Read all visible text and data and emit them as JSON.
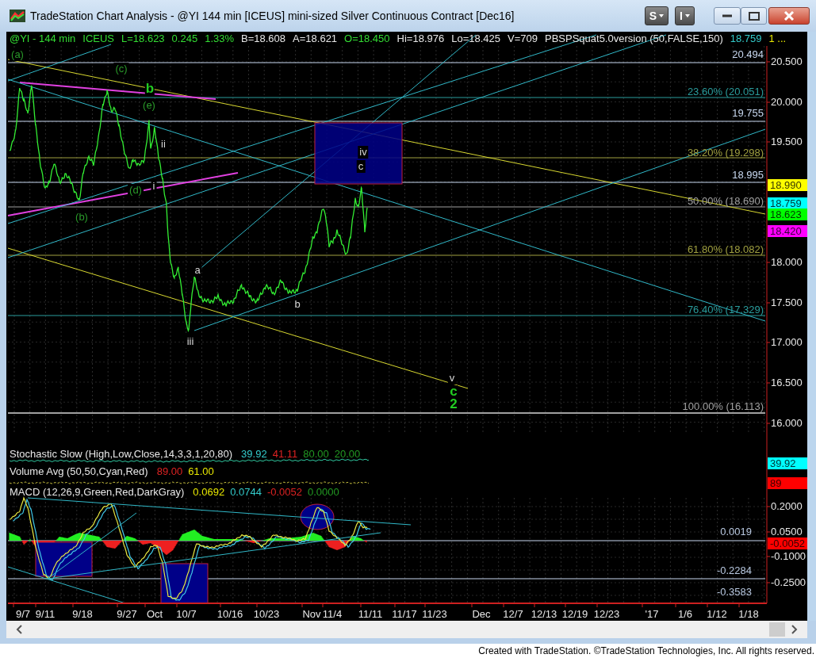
{
  "window": {
    "title": "TradeStation Chart Analysis - @YI 144 min [ICEUS] mini-sized Silver Continuous Contract [Dec16]"
  },
  "toolbar_buttons": [
    {
      "label": "S"
    },
    {
      "label": "I"
    }
  ],
  "symbol_header": [
    {
      "text": "@YI - 144 min",
      "color": "#33dd33"
    },
    {
      "text": "ICEUS",
      "color": "#33dd33"
    },
    {
      "text": "L=18.623",
      "color": "#33dd33"
    },
    {
      "text": "0.245",
      "color": "#33dd33"
    },
    {
      "text": "1.33%",
      "color": "#33dd33"
    },
    {
      "text": "B=18.608",
      "color": "#e8e8e8"
    },
    {
      "text": "A=18.621",
      "color": "#e8e8e8"
    },
    {
      "text": "O=18.450",
      "color": "#33dd33"
    },
    {
      "text": "Hi=18.976",
      "color": "#e8e8e8"
    },
    {
      "text": "Lo=18.425",
      "color": "#e8e8e8"
    },
    {
      "text": "V=709",
      "color": "#e8e8e8"
    },
    {
      "text": "PBSPSquat5.0version (50,FALSE,150)",
      "color": "#e8e8e8"
    },
    {
      "text": "18.759",
      "color": "#33cccc"
    },
    {
      "text": "1 ...",
      "color": "#e8e800"
    }
  ],
  "wave_labels": [
    {
      "text": "(a)",
      "kind": "intermediate"
    },
    {
      "text": "(c)",
      "kind": "intermediate"
    },
    {
      "text": "b",
      "kind": "primary"
    },
    {
      "text": "(e)",
      "kind": "intermediate"
    },
    {
      "text": "ii",
      "kind": "minor"
    },
    {
      "text": "(d)",
      "kind": "intermediate"
    },
    {
      "text": "i",
      "kind": "minor"
    },
    {
      "text": "(b)",
      "kind": "intermediate"
    },
    {
      "text": "a",
      "kind": "minor"
    },
    {
      "text": "iii",
      "kind": "minor"
    },
    {
      "text": "b",
      "kind": "minor"
    },
    {
      "text": "iv",
      "kind": "minor"
    },
    {
      "text": "c",
      "kind": "minor"
    },
    {
      "text": "v",
      "kind": "minor"
    },
    {
      "text": "c",
      "kind": "primary"
    },
    {
      "text": "2",
      "kind": "primary"
    }
  ],
  "levels": [
    {
      "text": "20.494",
      "color": "#c8d8f0"
    },
    {
      "text": "23.60% (20.051)",
      "color": "#2a9d9d"
    },
    {
      "text": "19.755",
      "color": "#c8d8f0"
    },
    {
      "text": "38.20% (19.298)",
      "color": "#a0a040"
    },
    {
      "text": "18.995",
      "color": "#c8d8f0"
    },
    {
      "text": "50.00% (18.690)",
      "color": "#a0a0a0"
    },
    {
      "text": "61.80% (18.082)",
      "color": "#a0a040"
    },
    {
      "text": "76.40% (17.329)",
      "color": "#2a9d9d"
    },
    {
      "text": "100.00% (16.113)",
      "color": "#a0a0a0"
    }
  ],
  "price_axis": {
    "labels": [
      "20.500",
      "20.000",
      "19.500",
      "18.000",
      "17.500",
      "17.000",
      "16.500",
      "16.000"
    ]
  },
  "price_tags": [
    {
      "text": "18.990",
      "color": "#ffff00"
    },
    {
      "text": "18.759",
      "color": "#00ffff"
    },
    {
      "text": "18.623",
      "color": "#00ff00"
    },
    {
      "text": "18.420",
      "color": "#ff00ff"
    }
  ],
  "indicators": [
    {
      "name": "Stochastic Slow (High,Low,Close,14,3,3,1,20,80)",
      "values": [
        {
          "text": "39.92",
          "color": "#33cccc"
        },
        {
          "text": "41.11",
          "color": "#dd2222"
        },
        {
          "text": "80.00",
          "color": "#229922"
        },
        {
          "text": "20.00",
          "color": "#229922"
        }
      ]
    },
    {
      "name": "Volume Avg (50,50,Cyan,Red)",
      "values": [
        {
          "text": "89.00",
          "color": "#dd2222"
        },
        {
          "text": "61.00",
          "color": "#e8e800"
        }
      ]
    },
    {
      "name": "MACD (12,26,9,Green,Red,DarkGray)",
      "values": [
        {
          "text": "0.0692",
          "color": "#e8e800"
        },
        {
          "text": "0.0744",
          "color": "#33cccc"
        },
        {
          "text": "-0.0052",
          "color": "#dd2222"
        },
        {
          "text": "0.0000",
          "color": "#229922"
        }
      ]
    }
  ],
  "indicator_tags": [
    {
      "text": "39.92",
      "color": "#00ffff"
    },
    {
      "text": "89",
      "color": "#ff0000"
    }
  ],
  "macd_axis": {
    "labels": [
      "0.2000",
      "0.0500",
      "-0.1000",
      "-0.2500"
    ]
  },
  "macd_tag": {
    "text": "-0.0052",
    "color": "#ff0000"
  },
  "macd_levels": [
    {
      "text": "0.0019"
    },
    {
      "text": "-0.2284"
    },
    {
      "text": "-0.3583"
    }
  ],
  "dates": [
    "9/7",
    "9/11",
    "9/18",
    "9/27",
    "Oct",
    "10/7",
    "10/16",
    "10/23",
    "Nov",
    "11/4",
    "11/11",
    "11/17",
    "11/23",
    "Dec",
    "12/7",
    "12/13",
    "12/19",
    "12/23",
    "'17",
    "1/6",
    "1/12",
    "1/18"
  ],
  "footer": "Created with TradeStation. ©TradeStation Technologies, Inc. All rights reserved."
}
